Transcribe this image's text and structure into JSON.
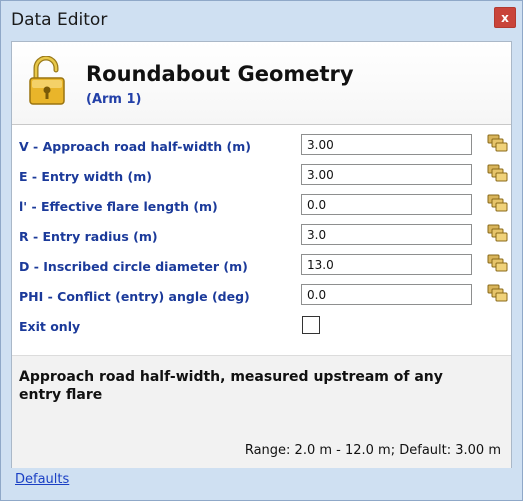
{
  "window": {
    "title": "Data Editor",
    "close_label": "x"
  },
  "header": {
    "title": "Roundabout Geometry",
    "subtitle": "(Arm 1)"
  },
  "fields": [
    {
      "label": "V - Approach road half-width (m)",
      "value": "3.00"
    },
    {
      "label": "E - Entry width (m)",
      "value": "3.00"
    },
    {
      "label": "l' - Effective flare length (m)",
      "value": "0.0"
    },
    {
      "label": "R - Entry radius (m)",
      "value": "3.0"
    },
    {
      "label": "D - Inscribed circle diameter (m)",
      "value": "13.0"
    },
    {
      "label": "PHI - Conflict (entry) angle (deg)",
      "value": "0.0"
    }
  ],
  "exit_only": {
    "label": "Exit only",
    "checked": false
  },
  "help": {
    "description": "Approach road half-width, measured upstream of any entry flare",
    "range": "Range: 2.0 m - 12.0 m; Default: 3.00 m"
  },
  "footer": {
    "defaults_link": "Defaults"
  },
  "colors": {
    "label": "#1b3a9a",
    "link": "#1a3fc4",
    "close": "#c9443a",
    "frame": "#cfe0f2"
  },
  "icons": {
    "header": "lock-open-icon",
    "field_button": "copy-stack-icon"
  }
}
